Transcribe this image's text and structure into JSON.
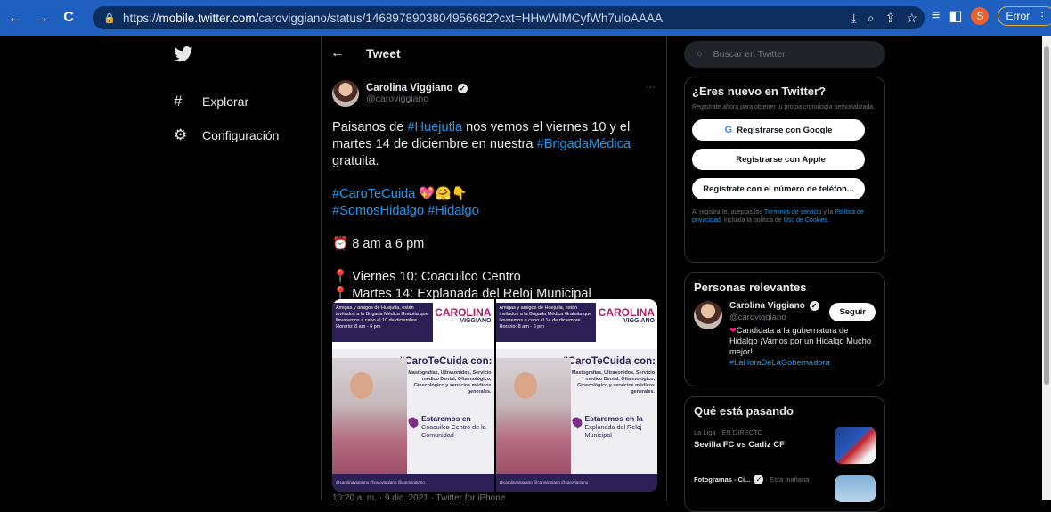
{
  "browser": {
    "url_scheme": "https://",
    "url_host": "mobile.twitter.com",
    "url_path": "/caroviggiano/status/1468978903804956682?cxt=HHwWlMCyfWh7uloAAAA",
    "profile_initial": "S",
    "error_label": "Error"
  },
  "nav": {
    "explore": "Explorar",
    "settings": "Configuración"
  },
  "tweet": {
    "header_title": "Tweet",
    "author_name": "Carolina Viggiano",
    "author_handle": "@caroviggiano",
    "p1_a": "Paisanos de ",
    "p1_tag1": "#Huejutla",
    "p1_b": " nos vemos el viernes 10 y el martes 14 de diciembre en nuestra ",
    "p1_tag2": "#BrigadaMédica",
    "p1_c": " gratuita.",
    "tag_carotecuida": "#CaroTeCuida",
    "emojis1": "💖🤗👇",
    "tag_somoshidalgo": "#SomosHidalgo",
    "tag_hidalgo": "#Hidalgo",
    "time_line": "⏰ 8 am a 6 pm",
    "loc1": "📍 Viernes 10: Coacuilco Centro",
    "loc2": "📍 Martes 14: Explanada del Reloj Municipal",
    "meta": "10:20 a. m. · 9 dic. 2021 · Twitter for iPhone",
    "posters": [
      {
        "band_text": "Amigas y amigos de Huejutla, están invitados a la Brigada Médica Gratuita que llevaremos a cabo el 10 de diciembre Horario: 8 am - 6 pm",
        "brand": "CAROLINA",
        "brand_sub": "VIGGIANO",
        "hashtag": "#CaroTeCuida con:",
        "services": "Mastografías, Ultrasonidos, Servicio médico Dental, Oftalmológico, Ginecológico y servicios médicos generales.",
        "where_title": "Estaremos en",
        "where_place": "Coacuilco Centro de la Comunidad",
        "footer": "@carolinaviggiano   @caroviggiano   @caroviggiano"
      },
      {
        "band_text": "Amigas y amigos de Huejutla, están invitados a la Brigada Médica Gratuita que llevaremos a cabo el 14 de diciembre Horario: 8 am - 6 pm",
        "brand": "CAROLINA",
        "brand_sub": "VIGGIANO",
        "hashtag": "#CaroTeCuida con:",
        "services": "Mastografías, Ultrasonidos, Servicio médico Dental, Oftalmológico, Ginecológico y servicios médicos generales.",
        "where_title": "Estaremos en la",
        "where_place": "Explanada del Reloj Municipal",
        "footer": "@carolinaviggiano   @caroviggiano   @caroviggiano"
      }
    ]
  },
  "sidebar": {
    "search_placeholder": "Buscar en Twitter",
    "new_title": "¿Eres nuevo en Twitter?",
    "new_sub": "Regístrate ahora para obtener tu propia cronología personalizada.",
    "google_btn": "Registrarse con Google",
    "apple_btn": "Registrarse con Apple",
    "phone_btn": "Regístrate con el número de teléfon...",
    "legal_a": "Al registrarte, aceptas los ",
    "legal_terms": "Términos de servicio",
    "legal_b": " y la ",
    "legal_privacy": "Política de privacidad",
    "legal_c": ", incluida la política de ",
    "legal_cookies": "Uso de Cookies",
    "legal_d": ".",
    "relevant_title": "Personas relevantes",
    "relevant_name": "Carolina Viggiano",
    "relevant_handle": "@caroviggiano",
    "follow_btn": "Seguir",
    "bio_text": "Candidata a la gubernatura de Hidalgo ¡Vamos por un Hidalgo Mucho mejor!",
    "bio_tag": "#LaHoraDeLaGobernadora",
    "happening_title": "Qué está pasando",
    "trend1_context": "La Liga · EN DIRECTO",
    "trend1_title": "Sevilla FC vs Cadiz CF",
    "trend2_source": "Fotogramas - Ci...",
    "trend2_time": " · Esta mañana"
  }
}
